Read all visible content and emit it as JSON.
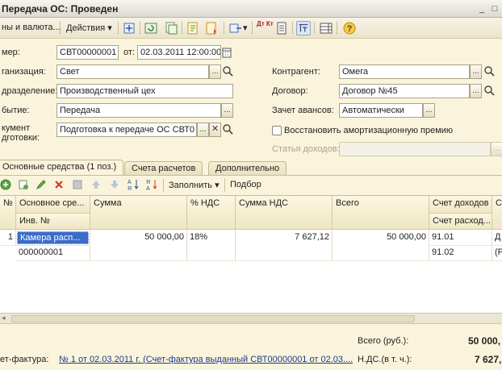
{
  "window": {
    "title": "Передача ОС: Проведен",
    "minimize_glyph": "_",
    "close_glyph": "□"
  },
  "toolbar": {
    "prices_menu": "ны и валюта...",
    "actions_menu": "Действия",
    "fill_menu_arrow": "▾",
    "icons": [
      "post-icon",
      "refresh-icon",
      "copy-icon",
      "structure-icon",
      "report-icon",
      "based-on-icon",
      "debit-credit-icon",
      "print-icon",
      "toggle-icon",
      "list-icon",
      "help-icon"
    ],
    "dt_kt_label": "Дт Кт",
    "help_glyph": "?"
  },
  "header": {
    "number_label": "мер:",
    "number_value": "СВТ00000001",
    "date_label": "от:",
    "date_value": "02.03.2011 12:00:00",
    "org_label": "ганизация:",
    "org_value": "Свет",
    "division_label": "дразделение:",
    "division_value": "Производственный цех",
    "event_label": "бытие:",
    "event_value": "Передача",
    "doc_label_1": "кумент",
    "doc_label_2": "дготовки:",
    "doc_value": "Подготовка к передаче ОС СВТ0",
    "contractor_label": "Контрагент:",
    "contractor_value": "Омега",
    "contract_label": "Договор:",
    "contract_value": "Договор №45",
    "advance_label": "Зачет авансов:",
    "advance_value": "Автоматически",
    "restore_label": "Восстановить амортизационную премию",
    "income_article_label": "Статья доходов:",
    "ellipsis": "...",
    "search_glyph": "🔍",
    "clear_glyph": "✕"
  },
  "tabs": [
    {
      "label": "Основные средства (1 поз.)",
      "active": true
    },
    {
      "label": "Счета расчетов",
      "active": false
    },
    {
      "label": "Дополнительно",
      "active": false
    }
  ],
  "table_toolbar": {
    "fill_label": "Заполнить",
    "pick_label": "Подбор"
  },
  "table": {
    "headers": {
      "n": "№",
      "asset": "Основное сре...",
      "inv": "Инв. №",
      "sum": "Сумма",
      "vat_pct": "% НДС",
      "vat_sum": "Сумма НДС",
      "total": "Всего",
      "income_acc": "Счет доходов",
      "expense_acc": "Счет расход...",
      "extra": "С"
    },
    "rows": [
      {
        "n": "1",
        "asset": "Камера расп...",
        "inv": "000000001",
        "sum": "50 000,00",
        "vat_pct": "18%",
        "vat_sum": "7 627,12",
        "total": "50 000,00",
        "income_acc": "91.01",
        "expense_acc": "91.02",
        "extra_1": "Д",
        "extra_2": "(Р"
      }
    ]
  },
  "footer": {
    "total_label": "Всего (руб.):",
    "total_value": "50 000,",
    "vat_label": "Н.ДС.(в т. ч.):",
    "vat_value": "7 627,",
    "invoice_label": "ет-фактура:",
    "invoice_link": "№ 1 от 02.03.2011 г. (Счет-фактура выданный СВТ00000001 от 02.03...."
  },
  "colors": {
    "background": "#fbf4dc",
    "selection": "#3a6cc8",
    "link": "#1a3c8c"
  }
}
